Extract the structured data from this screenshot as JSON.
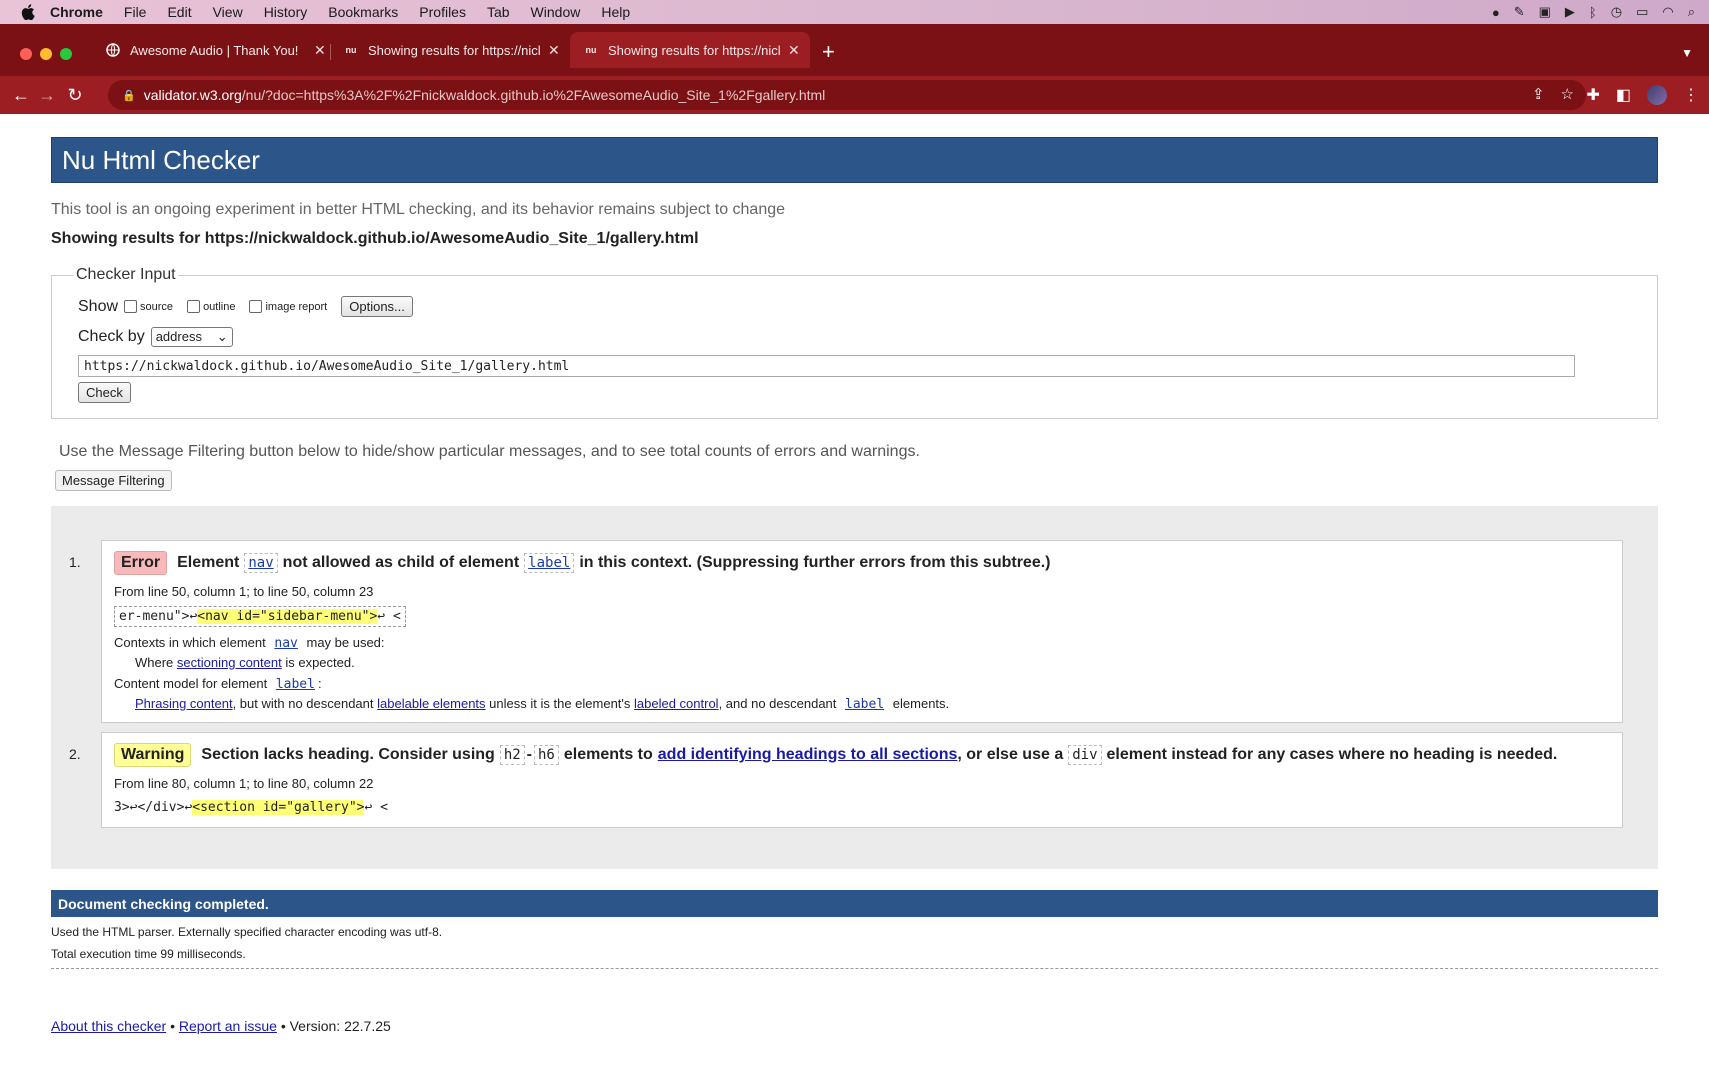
{
  "menubar": {
    "app": "Chrome",
    "items": [
      "File",
      "Edit",
      "View",
      "History",
      "Bookmarks",
      "Profiles",
      "Tab",
      "Window",
      "Help"
    ]
  },
  "tabs": [
    {
      "title": "Awesome Audio | Thank You!",
      "icon": "globe-icon"
    },
    {
      "title": "Showing results for https://nick",
      "icon": "nu-icon"
    },
    {
      "title": "Showing results for https://nick",
      "icon": "nu-icon"
    }
  ],
  "favicon_nu": "nu",
  "address": {
    "host": "validator.w3.org",
    "rest": "/nu/?doc=https%3A%2F%2Fnickwaldock.github.io%2FAwesomeAudio_Site_1%2Fgallery.html"
  },
  "page": {
    "title": "Nu Html Checker",
    "intro": "This tool is an ongoing experiment in better HTML checking, and its behavior remains subject to change",
    "showing": "Showing results for https://nickwaldock.github.io/AwesomeAudio_Site_1/gallery.html"
  },
  "checker_input": {
    "legend": "Checker Input",
    "show_label": "Show",
    "options": [
      "source",
      "outline",
      "image report"
    ],
    "options_button": "Options...",
    "check_by_label": "Check by",
    "check_by_value": "address",
    "url_value": "https://nickwaldock.github.io/AwesomeAudio_Site_1/gallery.html",
    "check_button": "Check"
  },
  "filter": {
    "info": "Use the Message Filtering button below to hide/show particular messages, and to see total counts of errors and warnings.",
    "button": "Message Filtering"
  },
  "messages": [
    {
      "num": "1.",
      "type": "Error",
      "t1": "Element",
      "c1": "nav",
      "t2": "not allowed as child of element",
      "c2": "label",
      "t3": "in this context. (Suppressing further errors from this subtree.)",
      "loc": "From line 50, column 1; to line 50, column 23",
      "ex_pre": "er-menu\">↩",
      "ex_hl": "<nav id=\"sidebar-menu\">",
      "ex_post": "↩    <",
      "ctx_a": "Contexts in which element",
      "ctx_code": "nav",
      "ctx_b": "may be used:",
      "where_a": "Where",
      "where_link": "sectioning content",
      "where_b": "is expected.",
      "cm_a": "Content model for element",
      "cm_code": "label",
      "cm_b": ":",
      "ph_link": "Phrasing content",
      "ph_a": ", but with no descendant",
      "ph_link2": "labelable elements",
      "ph_b": "unless it is the element's",
      "ph_link3": "labeled control",
      "ph_c": ", and no descendant",
      "ph_code": "label",
      "ph_d": "elements."
    },
    {
      "num": "2.",
      "type": "Warning",
      "t1": "Section lacks heading. Consider using",
      "c1": "h2",
      "dash": "-",
      "c2": "h6",
      "t2": "elements to",
      "link": "add identifying headings to all sections",
      "t3": ", or else use a",
      "c3": "div",
      "t4": "element instead for any cases where no heading is needed.",
      "loc": "From line 80, column 1; to line 80, column 22",
      "ex_pre": "3>↩</div>↩",
      "ex_hl": "<section id=\"gallery\">",
      "ex_post": "↩    <"
    }
  ],
  "completed": "Document checking completed.",
  "meta1": "Used the HTML parser. Externally specified character encoding was utf-8.",
  "meta2": "Total execution time 99 milliseconds.",
  "footer": {
    "about": "About this checker",
    "sep": "•",
    "report": "Report an issue",
    "version": "• Version: 22.7.25"
  },
  "colors": {
    "brand": "#2c5689",
    "tabstrip": "#7b1114",
    "error": "#f7b9b9",
    "warning": "#ffff96"
  }
}
